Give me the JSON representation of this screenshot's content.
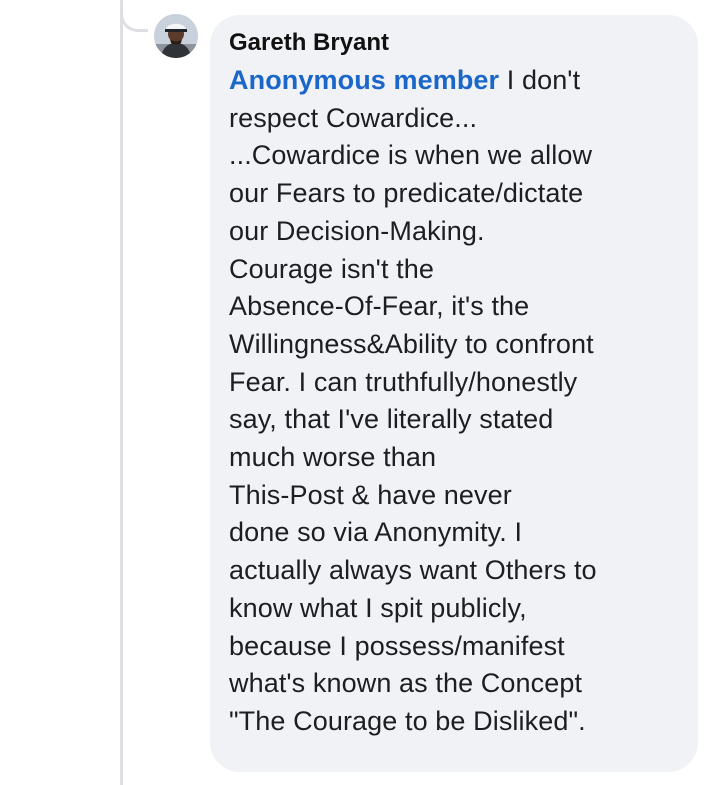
{
  "comment": {
    "author": "Gareth Bryant",
    "mention": "Anonymous member",
    "lines": [
      " I don't",
      "respect Cowardice...",
      "...Cowardice is when we allow",
      "our Fears to predicate/dictate",
      "our Decision-Making.",
      "Courage isn't the",
      "Absence-Of-Fear, it's the",
      "Willingness&Ability to confront",
      "Fear. I can truthfully/honestly",
      "say, that I've literally stated",
      "much worse than",
      "This-Post & have never",
      "done so via Anonymity. I",
      "actually always want Others to",
      "know what I spit publicly,",
      "because I possess/manifest",
      "what's known as the Concept",
      "\"The Courage to be Disliked\"."
    ]
  },
  "colors": {
    "bubble_background": "#f0f2f5",
    "mention": "#1b67c9",
    "thread_line": "#dddfe3"
  },
  "icons": {
    "avatar": "profile-photo-man-with-cap"
  }
}
